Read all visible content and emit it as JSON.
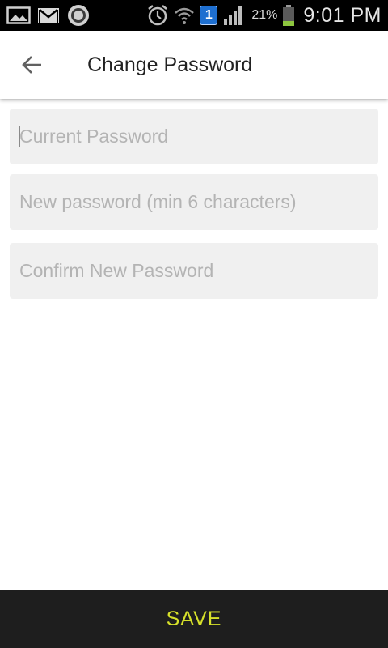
{
  "status_bar": {
    "left_icons": [
      "gallery-icon",
      "gmail-icon",
      "circle-app-icon"
    ],
    "right_icons": [
      "alarm-icon",
      "wifi-icon",
      "notification-badge",
      "signal-icon",
      "battery-icon"
    ],
    "notification_count": "1",
    "battery_percent": "21%",
    "time": "9:01 PM"
  },
  "app_bar": {
    "back_icon": "arrow-back-icon",
    "title": "Change Password"
  },
  "form": {
    "current_password_placeholder": "Current Password",
    "new_password_placeholder": "New password (min 6 characters)",
    "confirm_password_placeholder": "Confirm New Password"
  },
  "footer": {
    "save_label": "SAVE"
  },
  "colors": {
    "status_bar_bg": "#000000",
    "field_bg": "#f0f0f0",
    "save_bar_bg": "#1e1e1e",
    "save_label": "#d7e12a",
    "battery_fill": "#8dc63f"
  }
}
